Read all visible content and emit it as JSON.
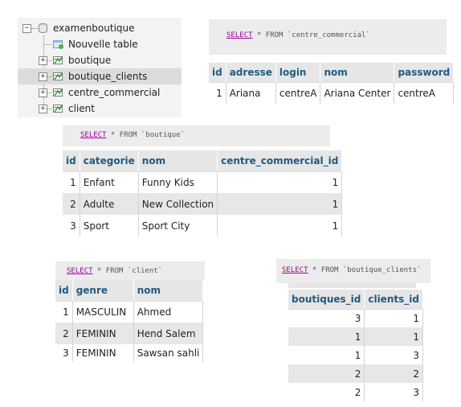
{
  "tree": {
    "database": "examenboutique",
    "new_table": "Nouvelle table",
    "tables": [
      "boutique",
      "boutique_clients",
      "centre_commercial",
      "client"
    ]
  },
  "q_centre": {
    "select": "SELECT",
    "rest": " * FROM ",
    "table": "`centre_commercial`"
  },
  "centre": {
    "headers": [
      "id",
      "adresse",
      "login",
      "nom",
      "password"
    ],
    "rows": [
      [
        "1",
        "Ariana",
        "centreA",
        "Ariana Center",
        "centreA"
      ]
    ]
  },
  "q_boutique": {
    "select": "SELECT",
    "rest": " * FROM ",
    "table": "`boutique`"
  },
  "boutique": {
    "headers": [
      "id",
      "categorie",
      "nom",
      "centre_commercial_id"
    ],
    "rows": [
      [
        "1",
        "Enfant",
        "Funny Kids",
        "1"
      ],
      [
        "2",
        "Adulte",
        "New Collection",
        "1"
      ],
      [
        "3",
        "Sport",
        "Sport City",
        "1"
      ]
    ]
  },
  "q_client": {
    "select": "SELECT",
    "rest": " * FROM ",
    "table": "`client`"
  },
  "client": {
    "headers": [
      "id",
      "genre",
      "nom"
    ],
    "rows": [
      [
        "1",
        "MASCULIN",
        "Ahmed"
      ],
      [
        "2",
        "FEMININ",
        "Hend Salem"
      ],
      [
        "3",
        "FEMININ",
        "Sawsan sahli"
      ]
    ]
  },
  "q_bc": {
    "select": "SELECT",
    "rest": " * FROM ",
    "table": "`boutique_clients`"
  },
  "bc": {
    "headers": [
      "boutiques_id",
      "clients_id"
    ],
    "rows": [
      [
        "3",
        "1"
      ],
      [
        "1",
        "1"
      ],
      [
        "1",
        "3"
      ],
      [
        "2",
        "2"
      ],
      [
        "2",
        "3"
      ]
    ]
  },
  "colors": {
    "header_text": "#235a81",
    "keyword": "#990099",
    "stripe": "#e7e7e7",
    "query_bg": "#ececec"
  },
  "icons": {
    "db": "database-icon",
    "table": "table-icon",
    "new_table": "new-table-icon",
    "expand": "plus-expander-icon",
    "collapse": "minus-expander-icon"
  }
}
